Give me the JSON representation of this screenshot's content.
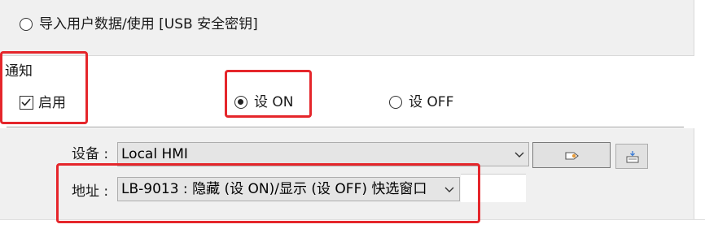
{
  "import_option": {
    "label": "导入用户数据/使用 [USB 安全密钥]",
    "selected": false
  },
  "notification": {
    "group_label": "通知",
    "enable_label": "启用",
    "enable_checked": true,
    "set_on_label": "设 ON",
    "set_on_selected": true,
    "set_off_label": "设 OFF",
    "set_off_selected": false
  },
  "device": {
    "label": "设备 :",
    "value": "Local HMI"
  },
  "address": {
    "label": "地址 :",
    "value": "LB-9013 : 隐藏 (设 ON)/显示 (设 OFF) 快选窗口"
  },
  "icons": {
    "tag_button": "tag-icon",
    "keyboard_button": "keyboard-icon"
  },
  "colors": {
    "highlight": "#e5262b",
    "panel": "#f0f0f0"
  }
}
